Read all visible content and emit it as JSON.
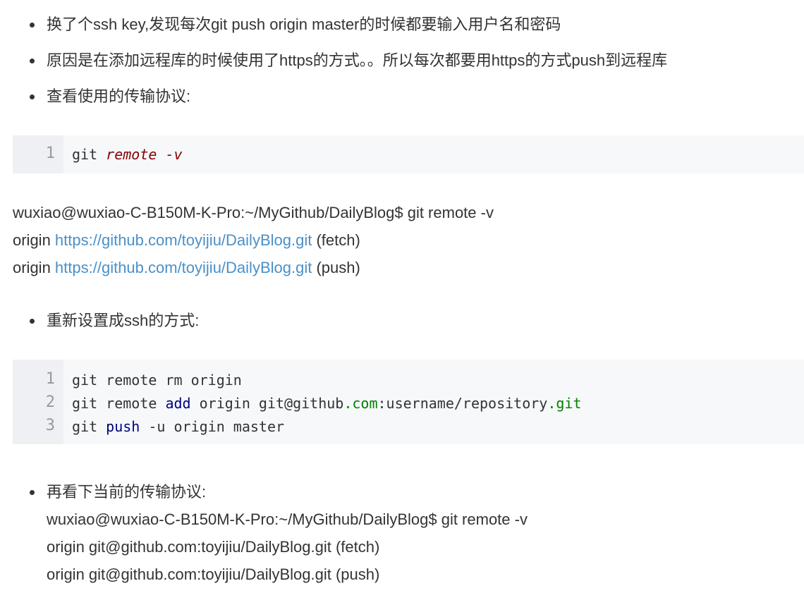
{
  "bullets": [
    "换了个ssh key,发现每次git push origin master的时候都要输入用户名和密码",
    "原因是在添加远程库的时候使用了https的方式。。所以每次都要用https的方式push到远程库",
    "查看使用的传输协议:",
    "重新设置成ssh的方式:",
    "再看下当前的传输协议:"
  ],
  "code_block_1": {
    "line_numbers": [
      "1"
    ],
    "line1": {
      "a": "git ",
      "b": "remote -v"
    }
  },
  "output_1": {
    "prompt": "wuxiao@wuxiao-C-B150M-K-Pro:~/MyGithub/DailyBlog$ git remote -v",
    "fetch_prefix": "origin ",
    "fetch_url": "https://github.com/toyijiu/DailyBlog.git",
    "fetch_suffix": " (fetch)",
    "push_prefix": "origin ",
    "push_url": "https://github.com/toyijiu/DailyBlog.git",
    "push_suffix": " (push)"
  },
  "code_block_2": {
    "line_numbers": [
      "1",
      "2",
      "3"
    ],
    "line1": "git remote rm origin",
    "line2": {
      "a": "git remote ",
      "b": "add",
      "c": " origin git@github",
      "d": ".com",
      "e": ":username/repository",
      "f": ".git"
    },
    "line3": {
      "a": "git ",
      "b": "push",
      "c": " -u origin master"
    }
  },
  "output_2": {
    "prompt": "wuxiao@wuxiao-C-B150M-K-Pro:~/MyGithub/DailyBlog$ git remote -v",
    "fetch": "origin git@github.com:toyijiu/DailyBlog.git (fetch)",
    "push": "origin git@github.com:toyijiu/DailyBlog.git (push)"
  }
}
